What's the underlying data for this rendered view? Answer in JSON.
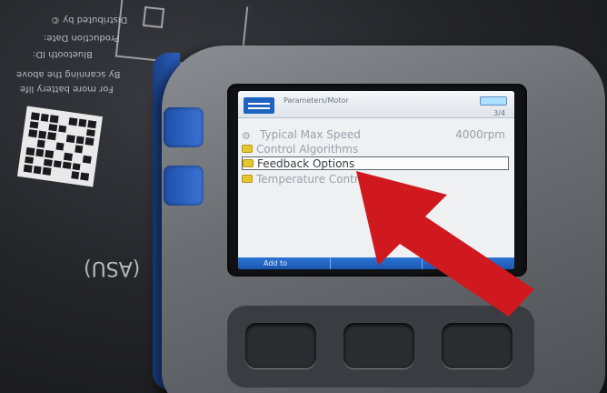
{
  "screen": {
    "title": "Parameters/Motor",
    "page_indicator": "3/4",
    "menu_items": [
      {
        "label": "Typical Max Speed",
        "value": "4000rpm",
        "icon": "gear-icon",
        "selected": false
      },
      {
        "label": "Control Algorithms",
        "value": "",
        "icon": "folder-icon",
        "selected": false
      },
      {
        "label": "Feedback Options",
        "value": "",
        "icon": "folder-icon",
        "selected": true
      },
      {
        "label": "Temperature Control",
        "value": "",
        "icon": "folder-icon",
        "selected": false
      }
    ],
    "softkeys": [
      "Add to",
      "",
      ""
    ]
  },
  "background": {
    "paper_lines": [
      "For more battery life",
      "By scanning the above",
      "Bluetooth ID:",
      "Production Date:",
      "Distributed by ©"
    ],
    "paper_text_2": "(ASU)"
  },
  "annotation": {
    "arrow_color": "#d0191f",
    "arrow_points_to": "Feedback Options"
  }
}
